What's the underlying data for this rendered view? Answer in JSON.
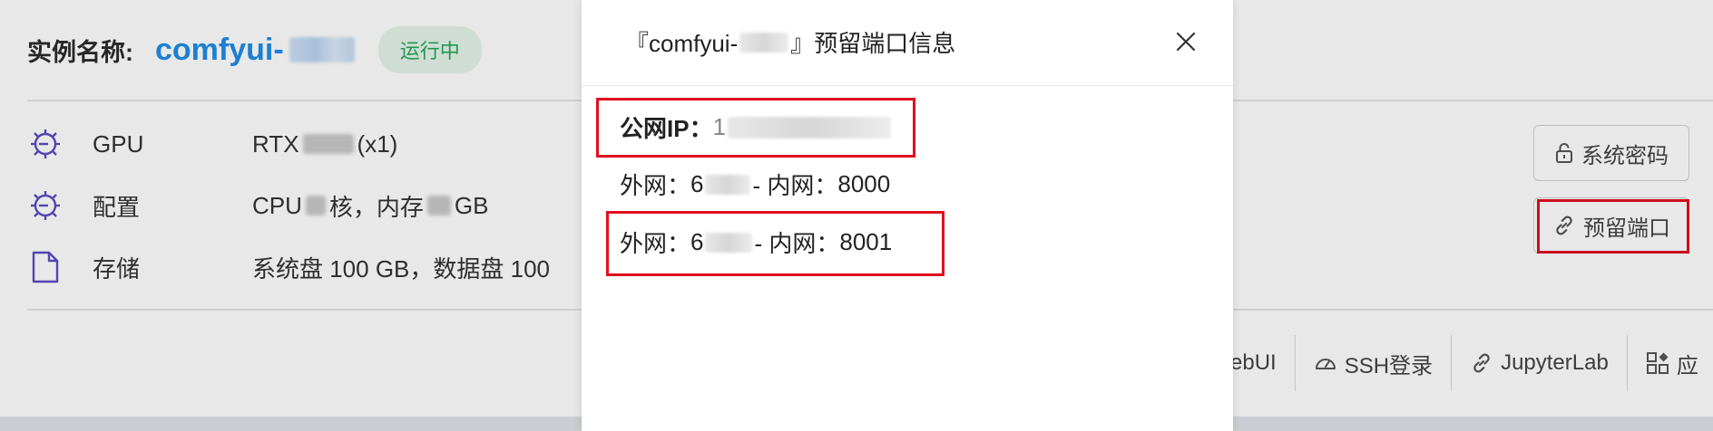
{
  "instance": {
    "name_label": "实例名称:",
    "name_prefix": "comfyui-",
    "status": "运行中"
  },
  "specs": [
    {
      "icon": "gpu-icon",
      "label": "GPU",
      "value_prefix": "RTX",
      "value_suffix": " (x1)"
    },
    {
      "icon": "config-icon",
      "label": "配置",
      "value_prefix": "CPU ",
      "value_mid": "核，内存 ",
      "value_suffix": " GB"
    },
    {
      "icon": "storage-icon",
      "label": "存储",
      "value": "系统盘 100 GB，数据盘 100"
    }
  ],
  "side_buttons": {
    "password": "系统密码",
    "reserved_port": "预留端口"
  },
  "actions": [
    {
      "icon": "",
      "label": "ebUI"
    },
    {
      "icon": "dashboard-icon",
      "label": "SSH登录"
    },
    {
      "icon": "link-icon",
      "label": "JupyterLab"
    },
    {
      "icon": "apps-icon",
      "label": "应"
    }
  ],
  "modal": {
    "title_prefix": "『comfyui-",
    "title_suffix": "』预留端口信息",
    "public_ip_label": "公网IP：",
    "public_ip_value_visible": "1",
    "port_rows": [
      {
        "external_label": "外网：",
        "external_visible": "6",
        "sep": " - 内网：",
        "internal": "8000"
      },
      {
        "external_label": "外网：",
        "external_visible": "6",
        "sep": " - 内网：",
        "internal": "8001"
      }
    ]
  },
  "colors": {
    "accent_blue": "#1f8ce8",
    "status_green": "#26a65b",
    "status_bg": "#e5f3ea",
    "highlight_red": "#e0101f",
    "icon_purple": "#5b4bc4"
  }
}
